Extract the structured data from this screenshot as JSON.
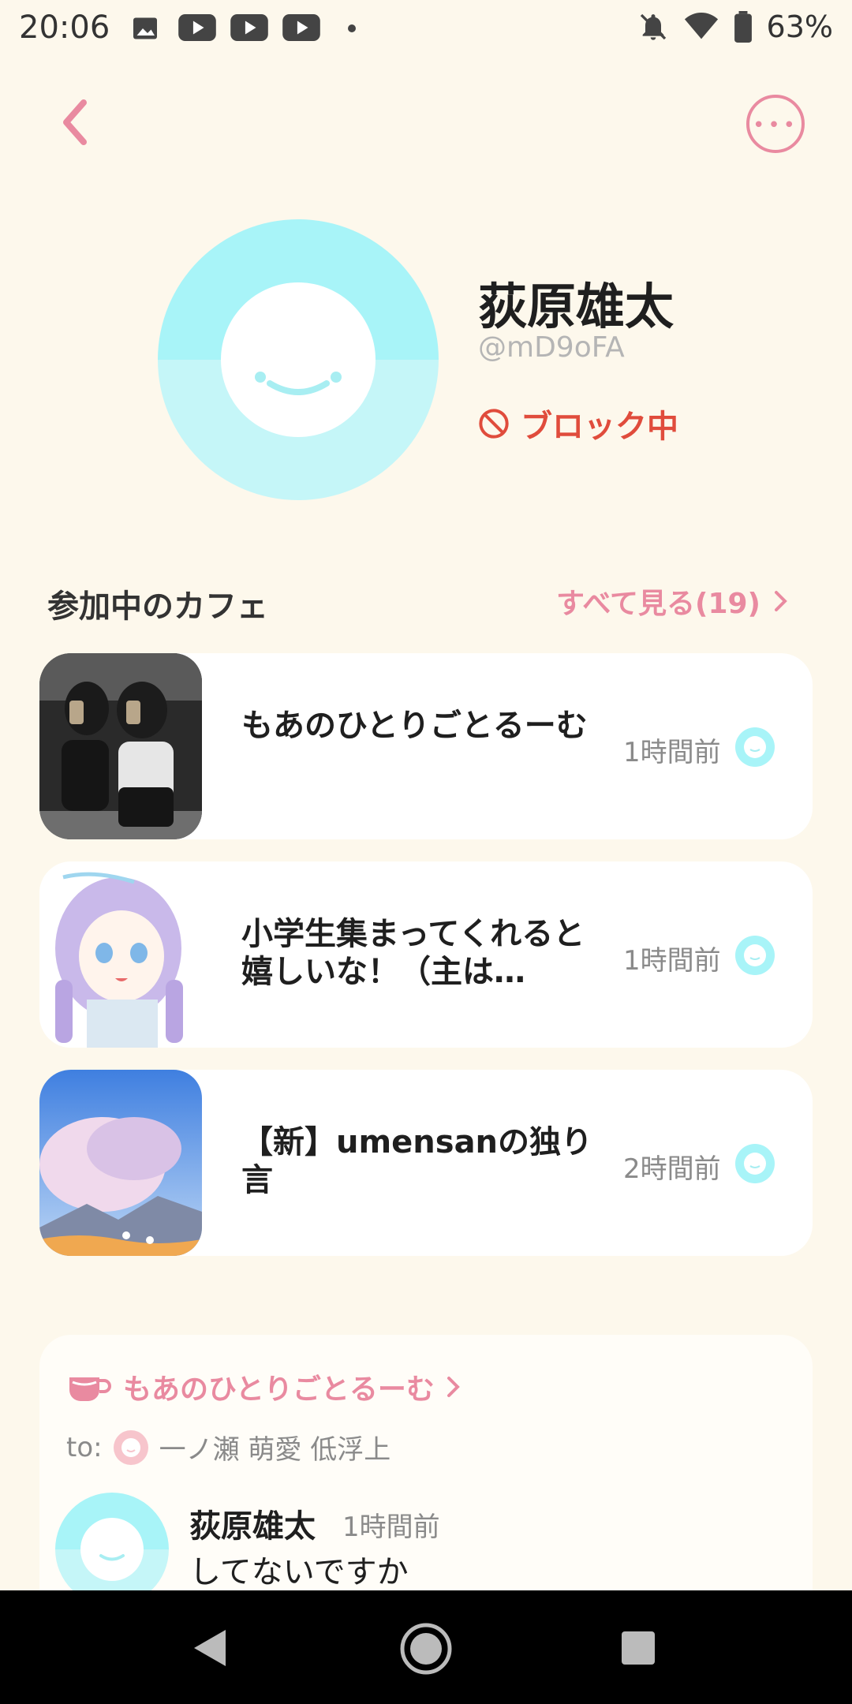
{
  "status_bar": {
    "time": "20:06",
    "battery": "63%"
  },
  "profile": {
    "name": "荻原雄太",
    "handle": "@mD9oFA",
    "block_status": "ブロック中"
  },
  "cafes_section": {
    "title": "参加中のカフェ",
    "see_all": "すべて見る(19)",
    "items": [
      {
        "title": "もあのひとりごとるーむ",
        "time": "1時間前"
      },
      {
        "title": "小学生集まってくれると嬉しいな！（主は…",
        "time": "1時間前"
      },
      {
        "title": "【新】umensanの独り言",
        "time": "2時間前"
      }
    ]
  },
  "post": {
    "cafe_name": "もあのひとりごとるーむ",
    "to_label": "to:",
    "to_name": "一ノ瀬 萌愛 低浮上",
    "author": "荻原雄太",
    "time": "1時間前",
    "text": "してないですか"
  },
  "colors": {
    "accent": "#e98aa0",
    "block": "#e04c3c",
    "avatar": "#a8f4f8",
    "background": "#fdf8ec"
  }
}
